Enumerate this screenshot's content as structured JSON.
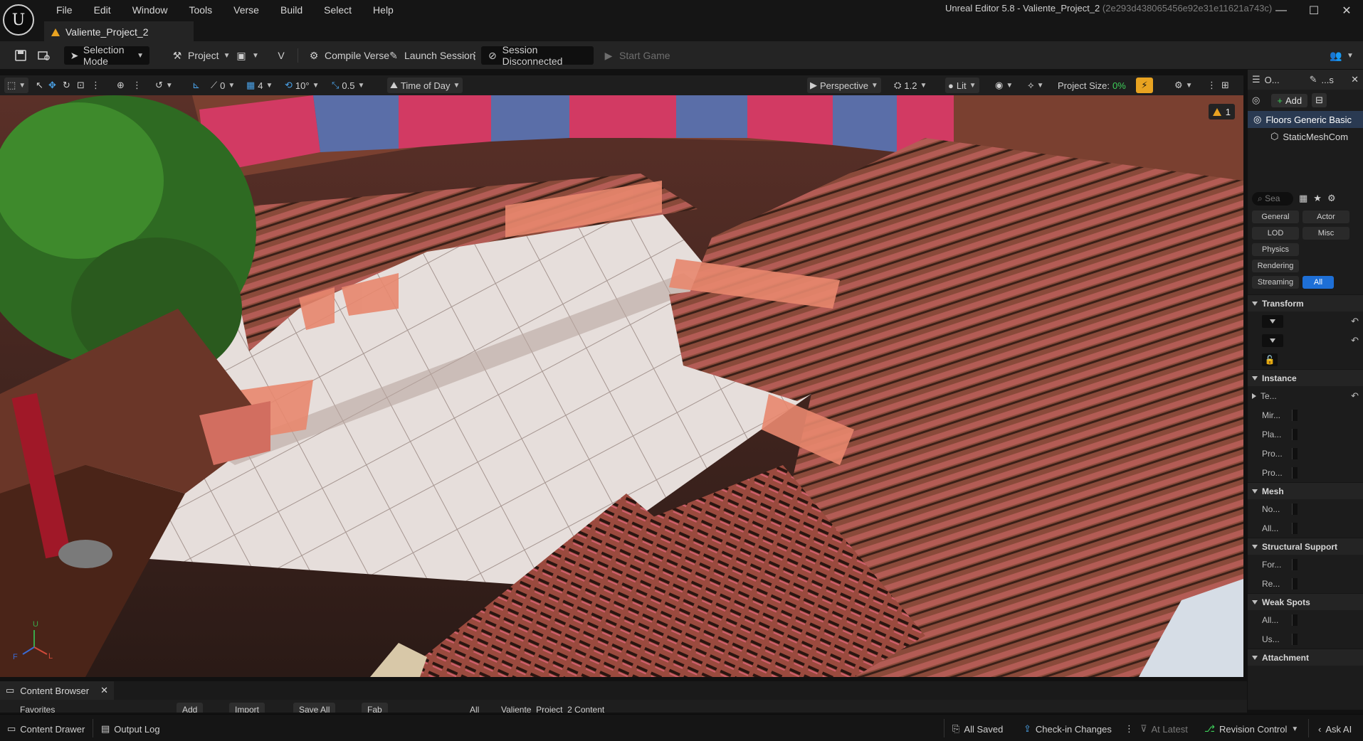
{
  "menu": [
    "File",
    "Edit",
    "Window",
    "Tools",
    "Verse",
    "Build",
    "Select",
    "Help"
  ],
  "window": {
    "title": "Unreal Editor 5.8 - Valiente_Project_2",
    "hash": "(2e293d438065456e92e31e11621a743c)",
    "minimize": "—",
    "maximize": "☐",
    "close": "✕"
  },
  "doc_tab": {
    "label": "Valiente_Project_2"
  },
  "toolbar": {
    "selection_mode": "Selection Mode",
    "project": "Project",
    "compile_verse": "Compile Verse",
    "launch_session": "Launch Session",
    "session_status": "Session Disconnected",
    "start_game": "Start Game"
  },
  "viewport_toolbar": {
    "rotation_value": "0",
    "grid_value": "4",
    "angle_value": "10°",
    "scale_value": "0.5",
    "time_of_day": "Time of Day",
    "perspective": "Perspective",
    "camera_speed": "1.2",
    "lit": "Lit",
    "project_size_label": "Project Size:",
    "project_size_value": "0%"
  },
  "viewport": {
    "warning_count": "1",
    "axis_u": "U",
    "axis_l": "L",
    "axis_f": "F"
  },
  "outliner": {
    "tab_label": "O...",
    "details_tab_label": "...s",
    "add_label": "Add",
    "items": [
      {
        "label": "Floors Generic Basic"
      },
      {
        "label": "StaticMeshCom"
      }
    ],
    "search_placeholder": "Sea"
  },
  "details": {
    "filters": [
      "General",
      "Actor",
      "LOD",
      "Misc",
      "Physics",
      "Rendering",
      "Streaming",
      "All"
    ],
    "categories": {
      "transform": "Transform",
      "instance": "Instance",
      "mesh": "Mesh",
      "structural_support": "Structural Support",
      "weak_spots": "Weak Spots",
      "attachment": "Attachment"
    },
    "instance_props": [
      "Te...",
      "Mir...",
      "Pla...",
      "Pro...",
      "Pro..."
    ],
    "mesh_props": [
      "No...",
      "All..."
    ],
    "structural_props": [
      "For...",
      "Re..."
    ],
    "weak_props": [
      "All...",
      "Us..."
    ]
  },
  "content_browser": {
    "tab_label": "Content Browser",
    "add": "Add",
    "import": "Import",
    "save_all": "Save All",
    "fab": "Fab",
    "favorites": "Favorites",
    "path_all": "All",
    "path_project": "Valiente_Project_2 Content"
  },
  "statusbar": {
    "content_drawer": "Content Drawer",
    "output_log": "Output Log",
    "all_saved": "All Saved",
    "check_in": "Check-in Changes",
    "at_latest": "At Latest",
    "revision_control": "Revision Control",
    "ask_ai": "Ask AI"
  }
}
